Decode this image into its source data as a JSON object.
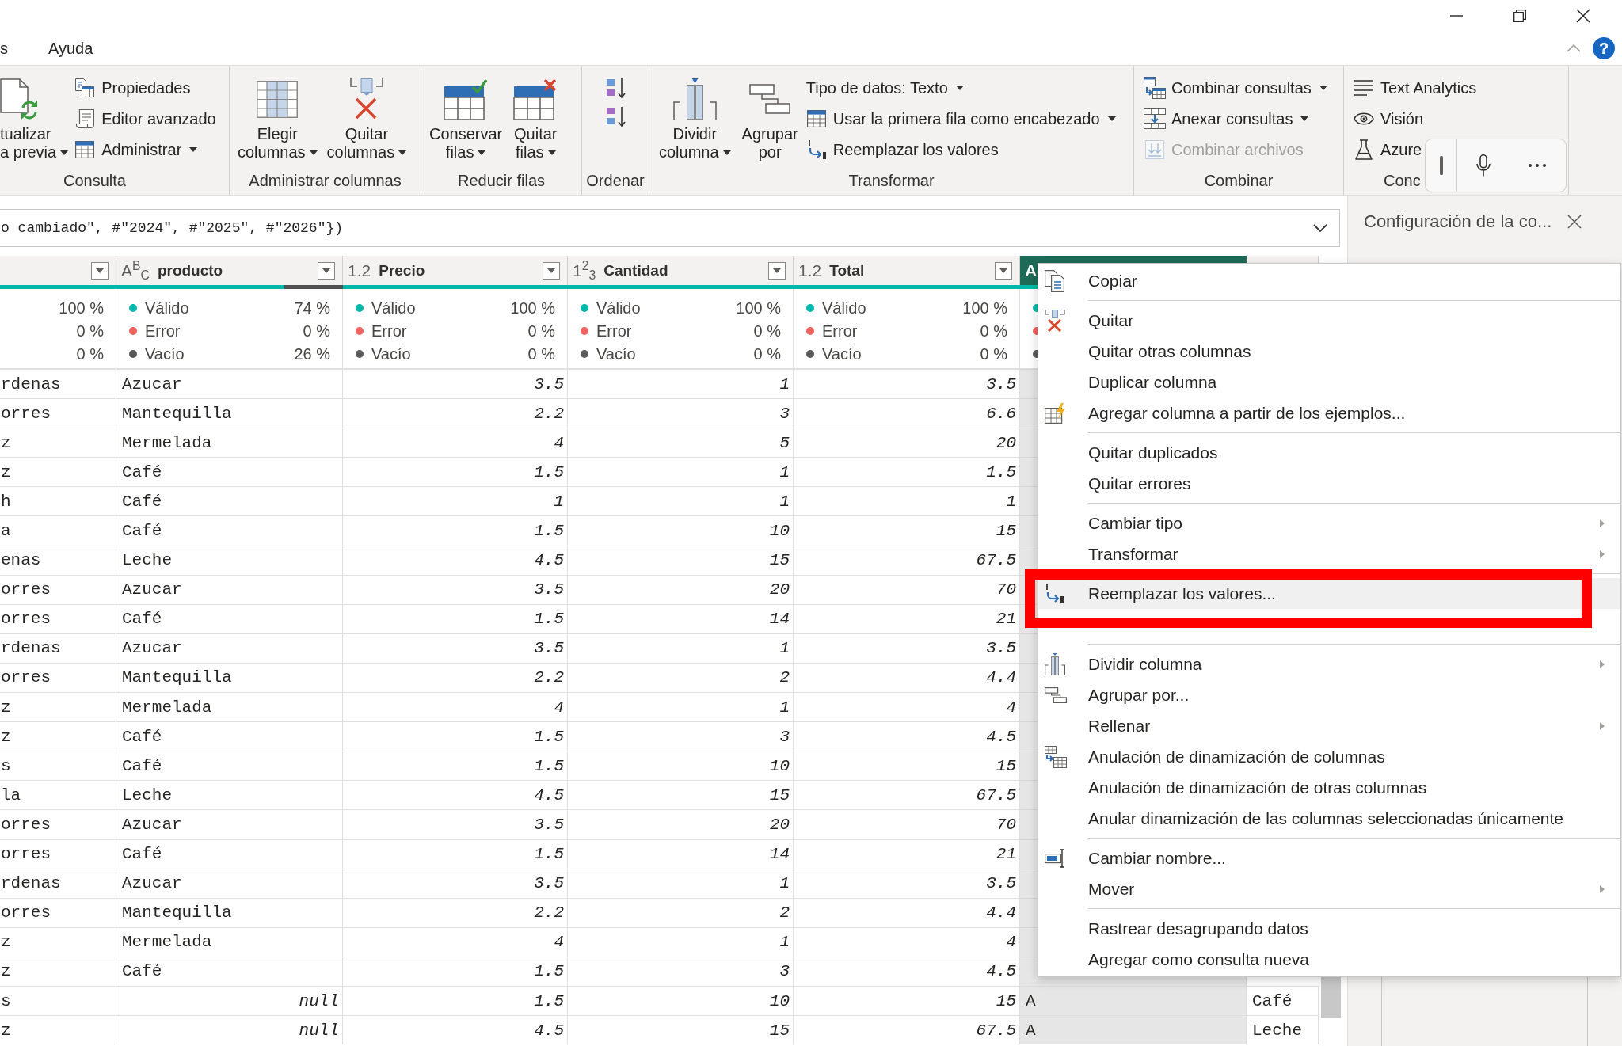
{
  "menu_tabs": [
    {
      "label": "s",
      "selected": false
    },
    {
      "label": "Ayuda",
      "selected": false
    }
  ],
  "help_button": {
    "label": "?"
  },
  "ribbon": {
    "groups": [
      {
        "label": "Consulta",
        "items": [
          {
            "kind": "large",
            "lines": [
              "tualizar",
              "a previa"
            ],
            "dropdown": true,
            "disabled": false
          },
          {
            "kind": "stack",
            "buttons": [
              {
                "label": "Propiedades",
                "dropdown": false,
                "disabled": false
              },
              {
                "label": "Editor avanzado",
                "dropdown": false,
                "disabled": false
              },
              {
                "label": "Administrar",
                "dropdown": true,
                "disabled": false
              }
            ]
          }
        ]
      },
      {
        "label": "Administrar columnas",
        "items": [
          {
            "kind": "large",
            "lines": [
              "Elegir",
              "columnas"
            ],
            "dropdown": true,
            "disabled": false
          },
          {
            "kind": "large",
            "lines": [
              "Quitar",
              "columnas"
            ],
            "dropdown": true,
            "disabled": false
          }
        ]
      },
      {
        "label": "Reducir filas",
        "items": [
          {
            "kind": "large",
            "lines": [
              "Conservar",
              "filas"
            ],
            "dropdown": true,
            "disabled": false
          },
          {
            "kind": "large",
            "lines": [
              "Quitar",
              "filas"
            ],
            "dropdown": true,
            "disabled": false
          }
        ]
      },
      {
        "label": "Ordenar",
        "items": [
          {
            "kind": "stack",
            "buttons": [
              {
                "dropdown": false,
                "disabled": false
              },
              {
                "dropdown": false,
                "disabled": false
              }
            ]
          }
        ]
      },
      {
        "label": "Transformar",
        "items": [
          {
            "kind": "large",
            "lines": [
              "Dividir",
              "columna"
            ],
            "dropdown": true,
            "disabled": false
          },
          {
            "kind": "large",
            "lines": [
              "Agrupar",
              "por"
            ],
            "dropdown": false,
            "disabled": false
          },
          {
            "kind": "stack",
            "buttons": [
              {
                "label": "Tipo de datos: Texto",
                "dropdown": true,
                "disabled": false
              },
              {
                "label": "Usar la primera fila como encabezado",
                "dropdown": true,
                "disabled": false
              },
              {
                "label": "Reemplazar los valores",
                "dropdown": false,
                "disabled": false
              }
            ]
          }
        ]
      },
      {
        "label": "Combinar",
        "items": [
          {
            "kind": "stack",
            "buttons": [
              {
                "label": "Combinar consultas",
                "dropdown": true,
                "disabled": false
              },
              {
                "label": "Anexar consultas",
                "dropdown": true,
                "disabled": false
              },
              {
                "label": "Combinar archivos",
                "dropdown": false,
                "disabled": true
              }
            ]
          }
        ]
      },
      {
        "label": "Conc",
        "items": [
          {
            "kind": "stack",
            "buttons": [
              {
                "label": "Text Analytics",
                "dropdown": false,
                "disabled": false
              },
              {
                "label": "Visión",
                "dropdown": false,
                "disabled": false
              },
              {
                "label": "Azure",
                "dropdown": false,
                "disabled": false
              }
            ]
          }
        ]
      }
    ]
  },
  "formula_bar": {
    "text": "o cambiado\", #\"2024\", #\"2025\", #\"2026\"})"
  },
  "table": {
    "columns": [
      {
        "kind": "text",
        "selected": false,
        "filter": true,
        "quality": {
          "level": 1
        },
        "stats": [
          {
            "value": "100 %"
          },
          {
            "value": "0 %"
          },
          {
            "value": "0 %"
          }
        ]
      },
      {
        "type_label": "A$^{B}$$_{C}$",
        "name": "producto",
        "kind": "text",
        "selected": false,
        "filter": true,
        "quality": {
          "level": 0.74
        },
        "stats": [
          {
            "label": "Válido",
            "value": "74 %",
            "color": "#01b8aa"
          },
          {
            "label": "Error",
            "value": "0 %",
            "color": "#f0605d"
          },
          {
            "label": "Vacío",
            "value": "26 %",
            "color": "#595959"
          }
        ]
      },
      {
        "type_label": "1.2",
        "name": "Precio",
        "kind": "number",
        "selected": false,
        "filter": true,
        "quality": {
          "level": 1
        },
        "stats": [
          {
            "label": "Válido",
            "value": "100 %",
            "color": "#01b8aa"
          },
          {
            "label": "Error",
            "value": "0 %",
            "color": "#f0605d"
          },
          {
            "label": "Vacío",
            "value": "0 %",
            "color": "#595959"
          }
        ]
      },
      {
        "type_label": "1$^{2}$$_{3}$",
        "name": "Cantidad",
        "kind": "number",
        "selected": false,
        "filter": true,
        "quality": {
          "level": 1
        },
        "stats": [
          {
            "label": "Válido",
            "value": "100 %",
            "color": "#01b8aa"
          },
          {
            "label": "Error",
            "value": "0 %",
            "color": "#f0605d"
          },
          {
            "label": "Vacío",
            "value": "0 %",
            "color": "#595959"
          }
        ]
      },
      {
        "type_label": "1.2",
        "name": "Total",
        "kind": "number",
        "selected": false,
        "filter": true,
        "quality": {
          "level": 1
        },
        "stats": [
          {
            "label": "Válido",
            "value": "100 %",
            "color": "#01b8aa"
          },
          {
            "label": "Error",
            "value": "0 %",
            "color": "#f0605d"
          },
          {
            "label": "Vacío",
            "value": "0 %",
            "color": "#595959"
          }
        ]
      },
      {
        "type_label": "A",
        "kind": "text",
        "selected": true,
        "quality": {
          "level": 1
        },
        "stats": [
          {
            "color": "#01b8aa"
          },
          {
            "color": "#f0605d"
          },
          {
            "color": "#595959"
          }
        ]
      },
      {
        "kind": "text",
        "selected": false
      }
    ],
    "rows": [
      {
        "cells": [
          "rdenas",
          "Azucar",
          "3.5",
          "1",
          "3.5"
        ]
      },
      {
        "cells": [
          "orres",
          "Mantequilla",
          "2.2",
          "3",
          "6.6"
        ]
      },
      {
        "cells": [
          "z",
          "Mermelada",
          "4",
          "5",
          "20"
        ]
      },
      {
        "cells": [
          "z",
          "Café",
          "1.5",
          "1",
          "1.5"
        ]
      },
      {
        "cells": [
          "h",
          "Café",
          "1",
          "1",
          "1"
        ]
      },
      {
        "cells": [
          "a",
          "Café",
          "1.5",
          "10",
          "15"
        ]
      },
      {
        "cells": [
          "enas",
          "Leche",
          "4.5",
          "15",
          "67.5"
        ]
      },
      {
        "cells": [
          "orres",
          "Azucar",
          "3.5",
          "20",
          "70"
        ]
      },
      {
        "cells": [
          "orres",
          "Café",
          "1.5",
          "14",
          "21"
        ]
      },
      {
        "cells": [
          "rdenas",
          "Azucar",
          "3.5",
          "1",
          "3.5"
        ]
      },
      {
        "cells": [
          "orres",
          "Mantequilla",
          "2.2",
          "2",
          "4.4"
        ]
      },
      {
        "cells": [
          "z",
          "Mermelada",
          "4",
          "1",
          "4"
        ]
      },
      {
        "cells": [
          "z",
          "Café",
          "1.5",
          "3",
          "4.5"
        ]
      },
      {
        "cells": [
          "s",
          "Café",
          "1.5",
          "10",
          "15"
        ]
      },
      {
        "cells": [
          "la",
          "Leche",
          "4.5",
          "15",
          "67.5"
        ]
      },
      {
        "cells": [
          "orres",
          "Azucar",
          "3.5",
          "20",
          "70"
        ]
      },
      {
        "cells": [
          "orres",
          "Café",
          "1.5",
          "14",
          "21"
        ]
      },
      {
        "cells": [
          "rdenas",
          "Azucar",
          "3.5",
          "1",
          "3.5"
        ]
      },
      {
        "cells": [
          "orres",
          "Mantequilla",
          "2.2",
          "2",
          "4.4"
        ]
      },
      {
        "cells": [
          "z",
          "Mermelada",
          "4",
          "1",
          "4"
        ]
      },
      {
        "cells": [
          "z",
          "Café",
          "1.5",
          "3",
          "4.5"
        ]
      },
      {
        "cells": [
          "s",
          {
            "text": "null",
            "kind": "null"
          },
          "1.5",
          "10",
          "15",
          "A",
          "Café"
        ]
      },
      {
        "cells": [
          "z",
          {
            "text": "null",
            "kind": "null"
          },
          "4.5",
          "15",
          "67.5",
          "A",
          "Leche"
        ]
      }
    ]
  },
  "query_settings": {
    "title": "Configuración de la co..."
  },
  "context_menu": {
    "sections": [
      {
        "items": [
          {
            "label": "Copiar",
            "submenu": false,
            "selected": false,
            "annotated": false
          }
        ]
      },
      {
        "items": [
          {
            "label": "Quitar",
            "submenu": false,
            "selected": false,
            "annotated": false
          },
          {
            "label": "Quitar otras columnas",
            "submenu": false,
            "selected": false,
            "annotated": false
          },
          {
            "label": "Duplicar columna",
            "submenu": false,
            "selected": false,
            "annotated": false
          },
          {
            "label": "Agregar columna a partir de los ejemplos...",
            "submenu": false,
            "selected": false,
            "annotated": false
          }
        ]
      },
      {
        "items": [
          {
            "label": "Quitar duplicados",
            "submenu": false,
            "selected": false,
            "annotated": false
          },
          {
            "label": "Quitar errores",
            "submenu": false,
            "selected": false,
            "annotated": false
          }
        ]
      },
      {
        "items": [
          {
            "label": "Cambiar tipo",
            "submenu": true,
            "selected": false,
            "annotated": false
          },
          {
            "label": "Transformar",
            "submenu": true,
            "selected": false,
            "annotated": false
          }
        ]
      },
      {
        "items": [
          {
            "label": "Reemplazar los valores...",
            "submenu": false,
            "selected": true,
            "annotated": true
          },
          {
            "submenu": false,
            "selected": false,
            "annotated": false
          }
        ]
      },
      {
        "items": [
          {
            "label": "Dividir columna",
            "submenu": true,
            "selected": false,
            "annotated": false
          },
          {
            "label": "Agrupar por...",
            "submenu": false,
            "selected": false,
            "annotated": false
          },
          {
            "label": "Rellenar",
            "submenu": true,
            "selected": false,
            "annotated": false
          },
          {
            "label": "Anulación de dinamización de columnas",
            "submenu": false,
            "selected": false,
            "annotated": false
          },
          {
            "label": "Anulación de dinamización de otras columnas",
            "submenu": false,
            "selected": false,
            "annotated": false
          },
          {
            "label": "Anular dinamización de las columnas seleccionadas únicamente",
            "submenu": false,
            "selected": false,
            "annotated": false
          }
        ]
      },
      {
        "items": [
          {
            "label": "Cambiar nombre...",
            "submenu": false,
            "selected": false,
            "annotated": false
          },
          {
            "label": "Mover",
            "submenu": true,
            "selected": false,
            "annotated": false
          }
        ]
      },
      {
        "items": [
          {
            "label": "Rastrear desagrupando datos",
            "submenu": false,
            "selected": false,
            "annotated": false
          },
          {
            "label": "Agregar como consulta nueva",
            "submenu": false,
            "selected": false,
            "annotated": false
          }
        ]
      }
    ]
  }
}
